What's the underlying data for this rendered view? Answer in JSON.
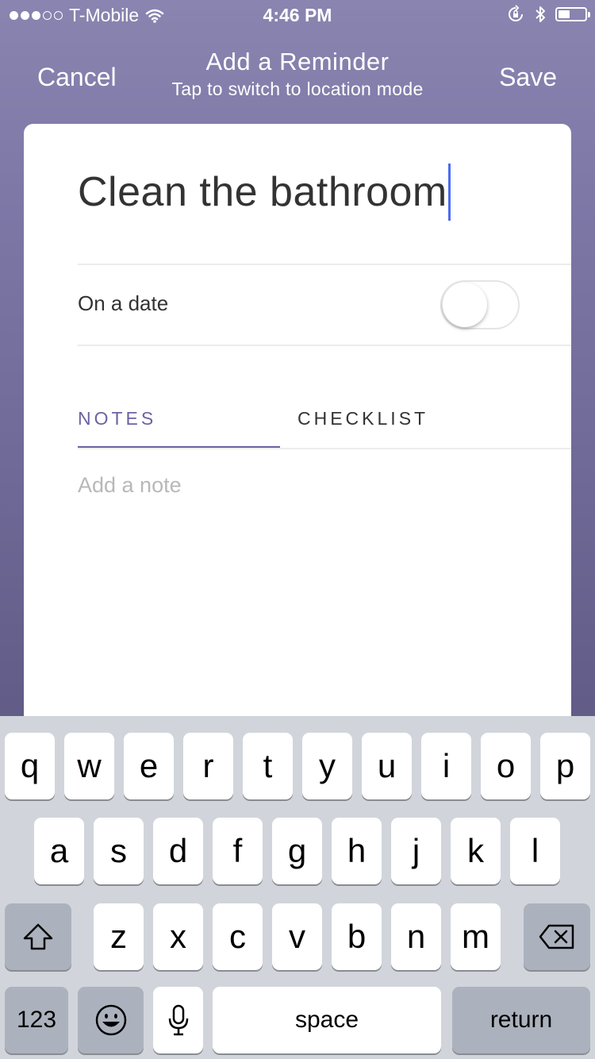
{
  "status_bar": {
    "carrier": "T-Mobile",
    "time": "4:46 PM",
    "signal_bars_filled": 3,
    "signal_bars_total": 5,
    "battery_level": 0.45,
    "icons": [
      "wifi-icon",
      "rotation-lock-icon",
      "bluetooth-icon",
      "battery-icon"
    ]
  },
  "nav": {
    "cancel_label": "Cancel",
    "title": "Add a Reminder",
    "subtitle": "Tap to switch to location mode",
    "save_label": "Save"
  },
  "reminder": {
    "title_value": "Clean the bathroom",
    "date_label": "On a date",
    "date_toggle_on": false
  },
  "tabs": [
    {
      "label": "NOTES",
      "active": true
    },
    {
      "label": "CHECKLIST",
      "active": false
    }
  ],
  "notes": {
    "placeholder": "Add a note",
    "value": ""
  },
  "keyboard": {
    "row1": [
      "q",
      "w",
      "e",
      "r",
      "t",
      "y",
      "u",
      "i",
      "o",
      "p"
    ],
    "row2": [
      "a",
      "s",
      "d",
      "f",
      "g",
      "h",
      "j",
      "k",
      "l"
    ],
    "row3": [
      "z",
      "x",
      "c",
      "v",
      "b",
      "n",
      "m"
    ],
    "numbers_label": "123",
    "space_label": "space",
    "return_label": "return",
    "icons": [
      "shift-icon",
      "backspace-icon",
      "emoji-icon",
      "microphone-icon"
    ]
  },
  "colors": {
    "accent": "#6b63a3",
    "caret": "#4a6cf0",
    "background_top": "#8a84b0",
    "background_bottom": "#554f7b",
    "keyboard_bg": "#d1d5db",
    "special_key": "#acb2bd"
  }
}
